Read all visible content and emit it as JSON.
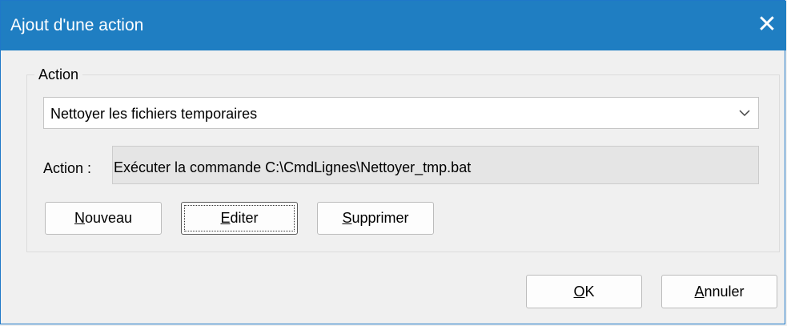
{
  "window": {
    "title": "Ajout d'une action",
    "close_glyph": "✕"
  },
  "group": {
    "label": "Action",
    "combo_value": "Nettoyer les fichiers temporaires",
    "action_label": "Action :",
    "action_value": "Exécuter la commande C:\\CmdLignes\\Nettoyer_tmp.bat"
  },
  "buttons": {
    "nouveau": {
      "mnemonic": "N",
      "rest": "ouveau"
    },
    "editer": {
      "mnemonic": "E",
      "rest": "diter"
    },
    "supprimer": {
      "mnemonic": "S",
      "rest": "upprimer"
    },
    "ok": {
      "mnemonic": "O",
      "rest": "K"
    },
    "annuler": {
      "mnemonic": "A",
      "rest": "nnuler"
    }
  },
  "icons": {
    "combo_arrow": "chevron-down-icon",
    "close": "close-icon"
  },
  "colors": {
    "titlebar": "#1f7ec2",
    "dialog_bg": "#f0f0f0",
    "readonly_field": "#e5e5e5"
  }
}
